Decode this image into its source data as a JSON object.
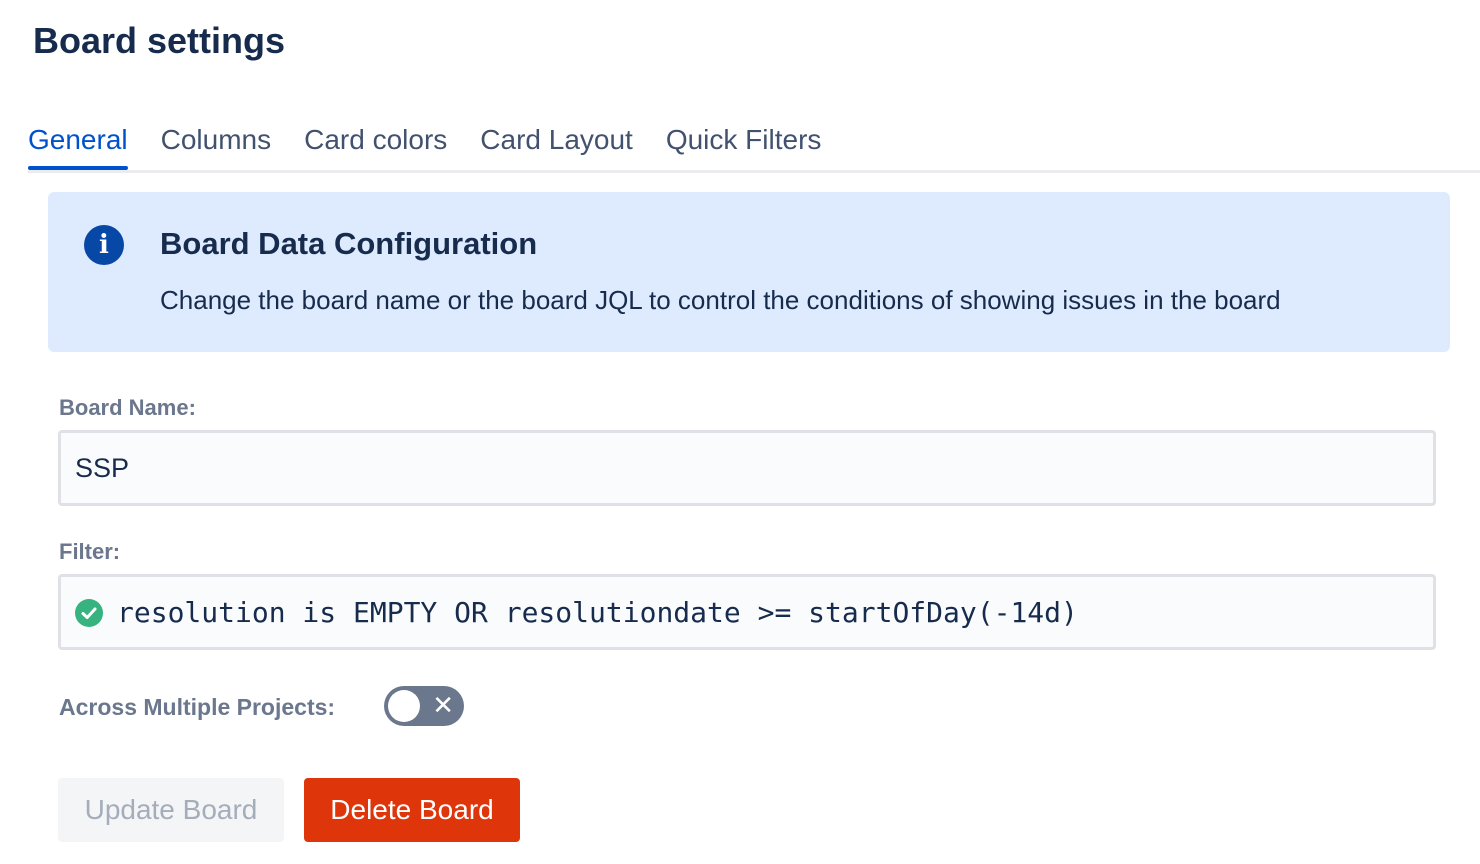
{
  "page": {
    "title": "Board settings"
  },
  "tabs": [
    {
      "label": "General",
      "active": true
    },
    {
      "label": "Columns",
      "active": false
    },
    {
      "label": "Card colors",
      "active": false
    },
    {
      "label": "Card Layout",
      "active": false
    },
    {
      "label": "Quick Filters",
      "active": false
    }
  ],
  "info_panel": {
    "icon": "info-icon",
    "icon_glyph": "i",
    "title": "Board Data Configuration",
    "description": "Change the board name or the board JQL to control the conditions of showing issues in the board",
    "background": "#deebff"
  },
  "board_name": {
    "label": "Board Name:",
    "value": "SSP"
  },
  "filter": {
    "label": "Filter:",
    "status_icon": "check-circle-icon",
    "status": "valid",
    "value": "resolution is EMPTY OR resolutiondate >= startOfDay(-14d)"
  },
  "multi_project": {
    "label": "Across Multiple Projects:",
    "enabled": false,
    "off_icon": "close-icon",
    "off_glyph": "✕"
  },
  "buttons": {
    "update_label": "Update Board",
    "update_disabled": true,
    "delete_label": "Delete Board",
    "delete_color": "#de350b"
  },
  "colors": {
    "accent": "#0052cc",
    "text": "#172b4d",
    "muted": "#6b778c",
    "success": "#36b37e"
  }
}
